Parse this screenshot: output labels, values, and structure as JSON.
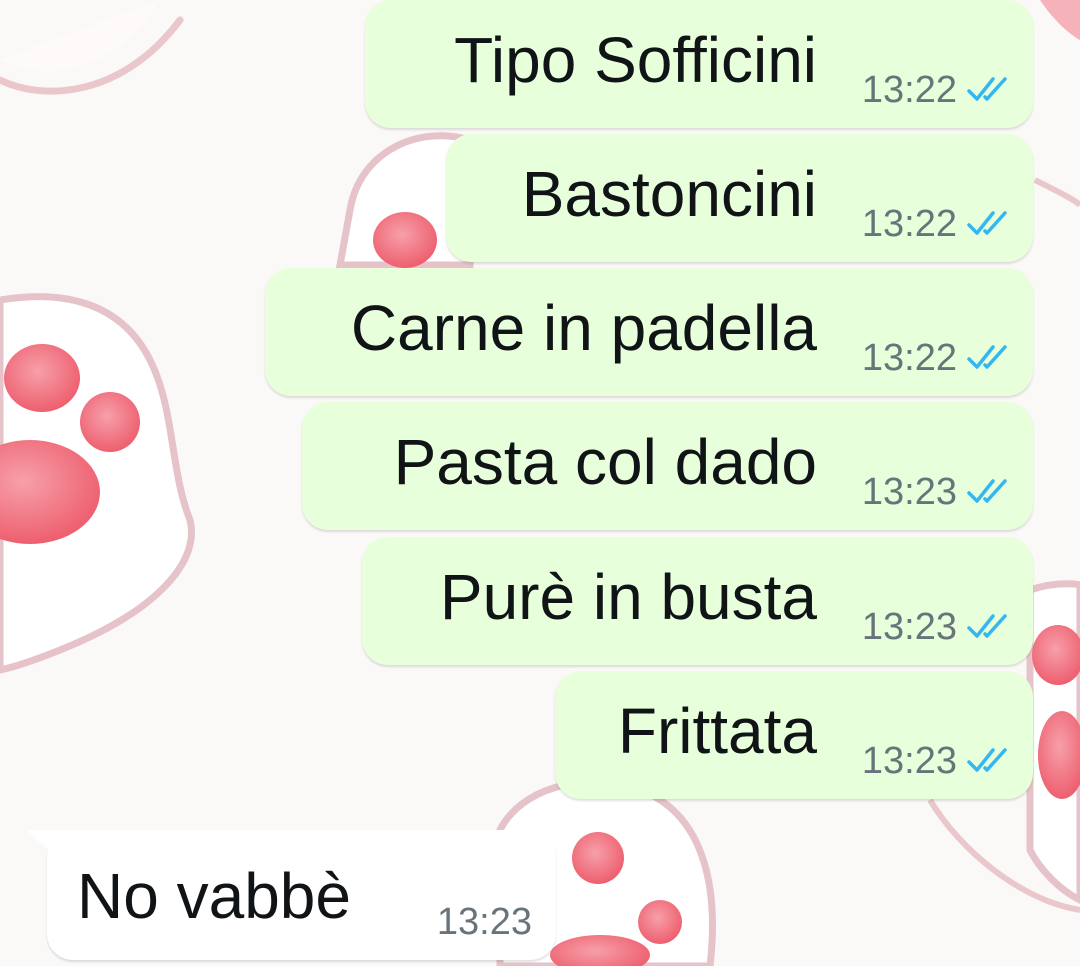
{
  "chat": {
    "outgoing": [
      {
        "text": "Tipo Sofficini",
        "time": "13:22",
        "status": "read-double-check-icon"
      },
      {
        "text": "Bastoncini",
        "time": "13:22",
        "status": "read-double-check-icon"
      },
      {
        "text": "Carne in padella",
        "time": "13:22",
        "status": "read-double-check-icon"
      },
      {
        "text": "Pasta col dado",
        "time": "13:23",
        "status": "read-double-check-icon"
      },
      {
        "text": "Purè in busta",
        "time": "13:23",
        "status": "read-double-check-icon"
      },
      {
        "text": "Frittata",
        "time": "13:23",
        "status": "read-double-check-icon"
      }
    ],
    "incoming": [
      {
        "text": "No vabbè",
        "time": "13:23"
      }
    ]
  },
  "colors": {
    "outgoing_bubble": "#e7ffdb",
    "incoming_bubble": "#ffffff",
    "read_ticks": "#34b7f1",
    "timestamp": "#68747a",
    "wallpaper_paw_pad": "#f0707e"
  }
}
